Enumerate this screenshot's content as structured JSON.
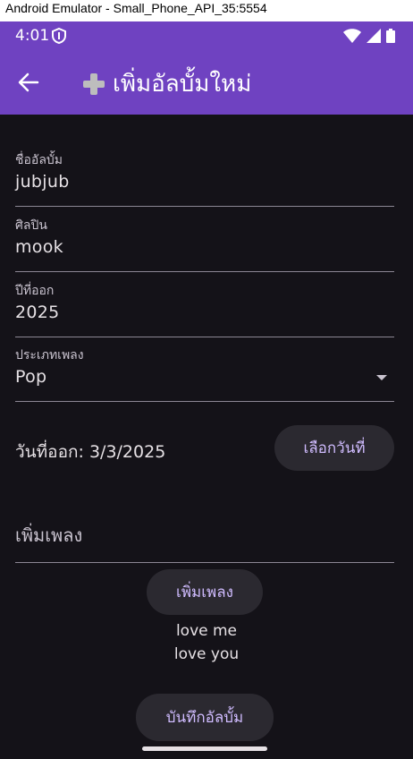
{
  "window": {
    "title": "Android Emulator - Small_Phone_API_35:5554"
  },
  "status_bar": {
    "time": "4:01"
  },
  "app_bar": {
    "title": "เพิ่มอัลบั้มใหม่"
  },
  "form": {
    "album_name": {
      "label": "ชื่ออัลบั้ม",
      "value": "jubjub"
    },
    "artist": {
      "label": "ศิลปิน",
      "value": "mook"
    },
    "year": {
      "label": "ปีที่ออก",
      "value": "2025"
    },
    "genre": {
      "label": "ประเภทเพลง",
      "value": "Pop"
    },
    "release_date": {
      "text": "วันที่ออก: 3/3/2025",
      "button_label": "เลือกวันที่"
    },
    "add_song": {
      "placeholder": "เพิ่มเพลง",
      "button_label": "เพิ่มเพลง"
    },
    "songs": [
      "love me",
      "love you"
    ],
    "save_button_label": "บันทึกอัลบั้ม"
  },
  "colors": {
    "app_bar": "#6f42c1",
    "background": "#141218",
    "button_bg": "#2b2930",
    "button_text": "#d0bcff"
  }
}
